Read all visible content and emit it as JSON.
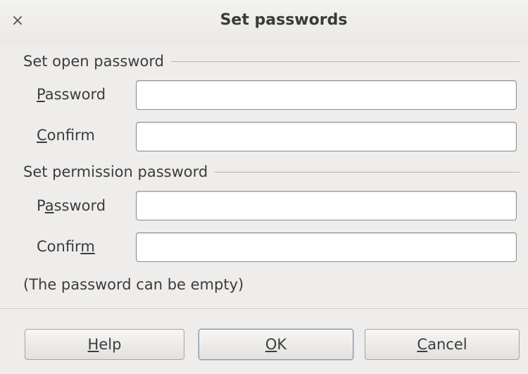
{
  "window": {
    "title": "Set passwords",
    "close_glyph": "×"
  },
  "open_section": {
    "header": "Set open password",
    "password_label": {
      "mnemonic": "P",
      "rest": "assword"
    },
    "confirm_label": {
      "mnemonic": "C",
      "rest": "onfirm"
    },
    "password_value": "",
    "confirm_value": ""
  },
  "permission_section": {
    "header": "Set permission password",
    "password_label": {
      "pre": "P",
      "mnemonic": "a",
      "rest": "ssword"
    },
    "confirm_label": {
      "pre": "Confir",
      "mnemonic": "m",
      "rest": ""
    },
    "password_value": "",
    "confirm_value": ""
  },
  "hint": "(The password can be empty)",
  "buttons": {
    "help": {
      "mnemonic": "H",
      "rest": "elp"
    },
    "ok": {
      "mnemonic": "O",
      "rest": "K"
    },
    "cancel": {
      "mnemonic": "C",
      "rest": "ancel"
    }
  }
}
